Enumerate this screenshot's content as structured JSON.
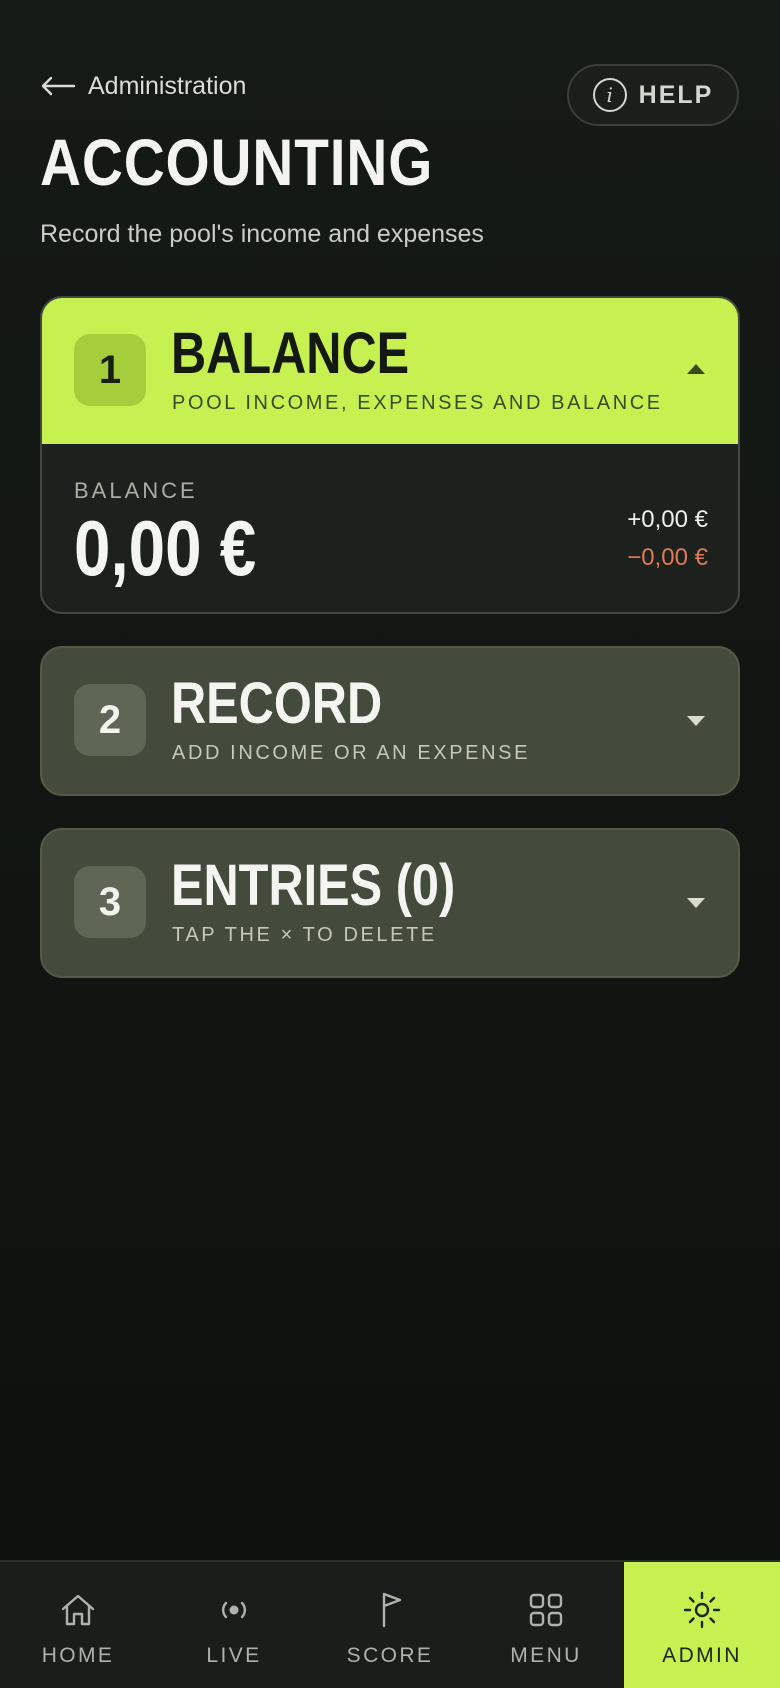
{
  "header": {
    "back_label": "Administration",
    "help_label": "HELP",
    "help_icon_glyph": "i",
    "title": "ACCOUNTING",
    "subtitle": "Record the pool's income and expenses"
  },
  "panels": {
    "balance": {
      "step": "1",
      "title": "BALANCE",
      "caption": "POOL INCOME, EXPENSES AND BALANCE",
      "expanded": true,
      "balance_label": "BALANCE",
      "balance_value": "0,00 €",
      "income_value": "+0,00 €",
      "expense_value": "−0,00 €"
    },
    "record": {
      "step": "2",
      "title": "RECORD",
      "caption": "ADD INCOME OR AN EXPENSE",
      "expanded": false
    },
    "entries": {
      "step": "3",
      "title": "ENTRIES (0)",
      "caption": "TAP THE × TO DELETE",
      "expanded": false
    }
  },
  "nav": {
    "items": [
      {
        "label": "HOME",
        "icon": "home-icon"
      },
      {
        "label": "LIVE",
        "icon": "live-icon"
      },
      {
        "label": "SCORE",
        "icon": "flag-icon"
      },
      {
        "label": "MENU",
        "icon": "grid-icon"
      },
      {
        "label": "ADMIN",
        "icon": "gear-icon",
        "active": true
      }
    ]
  },
  "colors": {
    "accent": "#c6f150",
    "background": "#121713",
    "panel_collapsed": "#434b3c",
    "panel_body": "#1d211d",
    "expense": "#e07a52"
  }
}
